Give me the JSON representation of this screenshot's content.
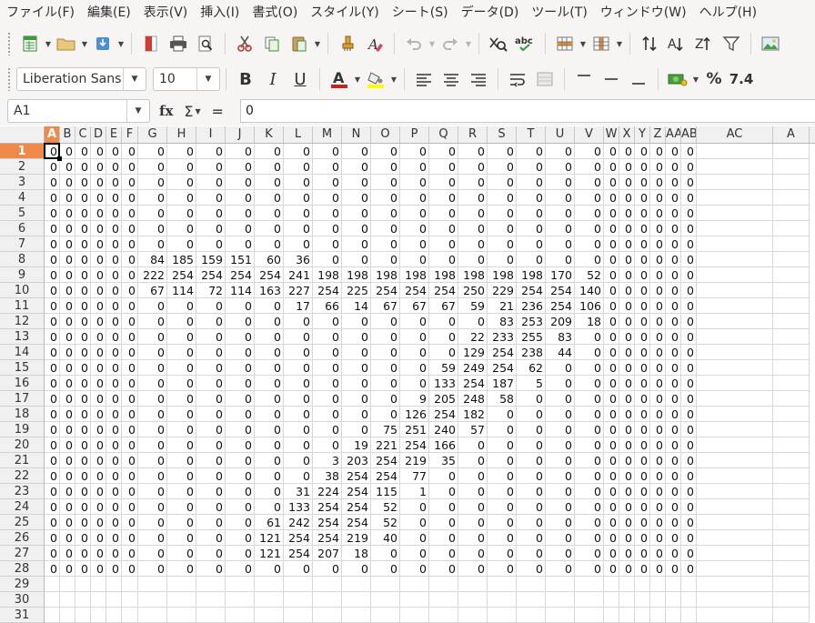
{
  "menu": [
    "ファイル(F)",
    "編集(E)",
    "表示(V)",
    "挿入(I)",
    "書式(O)",
    "スタイル(Y)",
    "シート(S)",
    "データ(D)",
    "ツール(T)",
    "ウィンドウ(W)",
    "ヘルプ(H)"
  ],
  "toolbar": {
    "font_name": "Liberation Sans",
    "font_size": "10",
    "percent_label": "%",
    "number_format_label": "7.4"
  },
  "formula_bar": {
    "cell_ref": "A1",
    "fx_label": "fx",
    "sigma_label": "Σ",
    "equals_label": "=",
    "content": "0"
  },
  "colors": {
    "selected_header": "#f08a4b",
    "font_color_bar": "#c9211e",
    "highlight_bar": "#ffff00"
  },
  "sheet": {
    "columns": [
      "A",
      "B",
      "C",
      "D",
      "E",
      "F",
      "G",
      "H",
      "I",
      "J",
      "K",
      "L",
      "M",
      "N",
      "O",
      "P",
      "Q",
      "R",
      "S",
      "T",
      "U",
      "V",
      "W",
      "X",
      "Y",
      "Z",
      "AA",
      "AB",
      "AC",
      "AD"
    ],
    "column_headers_visible": [
      "A",
      "B",
      "C",
      "D",
      "E",
      "F",
      "G",
      "H",
      "I",
      "J",
      "K",
      "L",
      "M",
      "N",
      "O",
      "P",
      "Q",
      "R",
      "S",
      "T",
      "U",
      "V",
      "W",
      "X",
      "Y",
      "Z",
      "AA",
      "AB",
      "AC",
      "A"
    ],
    "row_numbers": [
      "1",
      "2",
      "3",
      "4",
      "5",
      "6",
      "7",
      "8",
      "9",
      "10",
      "11",
      "12",
      "13",
      "14",
      "15",
      "16",
      "17",
      "18",
      "19",
      "20",
      "21",
      "22",
      "23",
      "24",
      "25",
      "26",
      "27",
      "28",
      "29",
      "30",
      "31"
    ],
    "selected_cell": "A1",
    "rows": [
      [
        0,
        0,
        0,
        0,
        0,
        0,
        0,
        0,
        0,
        0,
        0,
        0,
        0,
        0,
        0,
        0,
        0,
        0,
        0,
        0,
        0,
        0,
        0,
        0,
        0,
        0,
        0,
        0
      ],
      [
        0,
        0,
        0,
        0,
        0,
        0,
        0,
        0,
        0,
        0,
        0,
        0,
        0,
        0,
        0,
        0,
        0,
        0,
        0,
        0,
        0,
        0,
        0,
        0,
        0,
        0,
        0,
        0
      ],
      [
        0,
        0,
        0,
        0,
        0,
        0,
        0,
        0,
        0,
        0,
        0,
        0,
        0,
        0,
        0,
        0,
        0,
        0,
        0,
        0,
        0,
        0,
        0,
        0,
        0,
        0,
        0,
        0
      ],
      [
        0,
        0,
        0,
        0,
        0,
        0,
        0,
        0,
        0,
        0,
        0,
        0,
        0,
        0,
        0,
        0,
        0,
        0,
        0,
        0,
        0,
        0,
        0,
        0,
        0,
        0,
        0,
        0
      ],
      [
        0,
        0,
        0,
        0,
        0,
        0,
        0,
        0,
        0,
        0,
        0,
        0,
        0,
        0,
        0,
        0,
        0,
        0,
        0,
        0,
        0,
        0,
        0,
        0,
        0,
        0,
        0,
        0
      ],
      [
        0,
        0,
        0,
        0,
        0,
        0,
        0,
        0,
        0,
        0,
        0,
        0,
        0,
        0,
        0,
        0,
        0,
        0,
        0,
        0,
        0,
        0,
        0,
        0,
        0,
        0,
        0,
        0
      ],
      [
        0,
        0,
        0,
        0,
        0,
        0,
        0,
        0,
        0,
        0,
        0,
        0,
        0,
        0,
        0,
        0,
        0,
        0,
        0,
        0,
        0,
        0,
        0,
        0,
        0,
        0,
        0,
        0
      ],
      [
        0,
        0,
        0,
        0,
        0,
        0,
        84,
        185,
        159,
        151,
        60,
        36,
        0,
        0,
        0,
        0,
        0,
        0,
        0,
        0,
        0,
        0,
        0,
        0,
        0,
        0,
        0,
        0
      ],
      [
        0,
        0,
        0,
        0,
        0,
        0,
        222,
        254,
        254,
        254,
        254,
        241,
        198,
        198,
        198,
        198,
        198,
        198,
        198,
        198,
        170,
        52,
        0,
        0,
        0,
        0,
        0,
        0
      ],
      [
        0,
        0,
        0,
        0,
        0,
        0,
        67,
        114,
        72,
        114,
        163,
        227,
        254,
        225,
        254,
        254,
        254,
        250,
        229,
        254,
        254,
        140,
        0,
        0,
        0,
        0,
        0,
        0
      ],
      [
        0,
        0,
        0,
        0,
        0,
        0,
        0,
        0,
        0,
        0,
        0,
        17,
        66,
        14,
        67,
        67,
        67,
        59,
        21,
        236,
        254,
        106,
        0,
        0,
        0,
        0,
        0,
        0
      ],
      [
        0,
        0,
        0,
        0,
        0,
        0,
        0,
        0,
        0,
        0,
        0,
        0,
        0,
        0,
        0,
        0,
        0,
        0,
        83,
        253,
        209,
        18,
        0,
        0,
        0,
        0,
        0,
        0
      ],
      [
        0,
        0,
        0,
        0,
        0,
        0,
        0,
        0,
        0,
        0,
        0,
        0,
        0,
        0,
        0,
        0,
        0,
        22,
        233,
        255,
        83,
        0,
        0,
        0,
        0,
        0,
        0,
        0
      ],
      [
        0,
        0,
        0,
        0,
        0,
        0,
        0,
        0,
        0,
        0,
        0,
        0,
        0,
        0,
        0,
        0,
        0,
        129,
        254,
        238,
        44,
        0,
        0,
        0,
        0,
        0,
        0,
        0
      ],
      [
        0,
        0,
        0,
        0,
        0,
        0,
        0,
        0,
        0,
        0,
        0,
        0,
        0,
        0,
        0,
        0,
        59,
        249,
        254,
        62,
        0,
        0,
        0,
        0,
        0,
        0,
        0,
        0
      ],
      [
        0,
        0,
        0,
        0,
        0,
        0,
        0,
        0,
        0,
        0,
        0,
        0,
        0,
        0,
        0,
        0,
        133,
        254,
        187,
        5,
        0,
        0,
        0,
        0,
        0,
        0,
        0,
        0
      ],
      [
        0,
        0,
        0,
        0,
        0,
        0,
        0,
        0,
        0,
        0,
        0,
        0,
        0,
        0,
        0,
        9,
        205,
        248,
        58,
        0,
        0,
        0,
        0,
        0,
        0,
        0,
        0,
        0
      ],
      [
        0,
        0,
        0,
        0,
        0,
        0,
        0,
        0,
        0,
        0,
        0,
        0,
        0,
        0,
        0,
        126,
        254,
        182,
        0,
        0,
        0,
        0,
        0,
        0,
        0,
        0,
        0,
        0
      ],
      [
        0,
        0,
        0,
        0,
        0,
        0,
        0,
        0,
        0,
        0,
        0,
        0,
        0,
        0,
        75,
        251,
        240,
        57,
        0,
        0,
        0,
        0,
        0,
        0,
        0,
        0,
        0,
        0
      ],
      [
        0,
        0,
        0,
        0,
        0,
        0,
        0,
        0,
        0,
        0,
        0,
        0,
        0,
        19,
        221,
        254,
        166,
        0,
        0,
        0,
        0,
        0,
        0,
        0,
        0,
        0,
        0,
        0
      ],
      [
        0,
        0,
        0,
        0,
        0,
        0,
        0,
        0,
        0,
        0,
        0,
        0,
        3,
        203,
        254,
        219,
        35,
        0,
        0,
        0,
        0,
        0,
        0,
        0,
        0,
        0,
        0,
        0
      ],
      [
        0,
        0,
        0,
        0,
        0,
        0,
        0,
        0,
        0,
        0,
        0,
        0,
        38,
        254,
        254,
        77,
        0,
        0,
        0,
        0,
        0,
        0,
        0,
        0,
        0,
        0,
        0,
        0
      ],
      [
        0,
        0,
        0,
        0,
        0,
        0,
        0,
        0,
        0,
        0,
        0,
        31,
        224,
        254,
        115,
        1,
        0,
        0,
        0,
        0,
        0,
        0,
        0,
        0,
        0,
        0,
        0,
        0
      ],
      [
        0,
        0,
        0,
        0,
        0,
        0,
        0,
        0,
        0,
        0,
        0,
        133,
        254,
        254,
        52,
        0,
        0,
        0,
        0,
        0,
        0,
        0,
        0,
        0,
        0,
        0,
        0,
        0
      ],
      [
        0,
        0,
        0,
        0,
        0,
        0,
        0,
        0,
        0,
        0,
        61,
        242,
        254,
        254,
        52,
        0,
        0,
        0,
        0,
        0,
        0,
        0,
        0,
        0,
        0,
        0,
        0,
        0
      ],
      [
        0,
        0,
        0,
        0,
        0,
        0,
        0,
        0,
        0,
        0,
        121,
        254,
        254,
        219,
        40,
        0,
        0,
        0,
        0,
        0,
        0,
        0,
        0,
        0,
        0,
        0,
        0,
        0
      ],
      [
        0,
        0,
        0,
        0,
        0,
        0,
        0,
        0,
        0,
        0,
        121,
        254,
        207,
        18,
        0,
        0,
        0,
        0,
        0,
        0,
        0,
        0,
        0,
        0,
        0,
        0,
        0,
        0
      ],
      [
        0,
        0,
        0,
        0,
        0,
        0,
        0,
        0,
        0,
        0,
        0,
        0,
        0,
        0,
        0,
        0,
        0,
        0,
        0,
        0,
        0,
        0,
        0,
        0,
        0,
        0,
        0,
        0
      ]
    ]
  }
}
